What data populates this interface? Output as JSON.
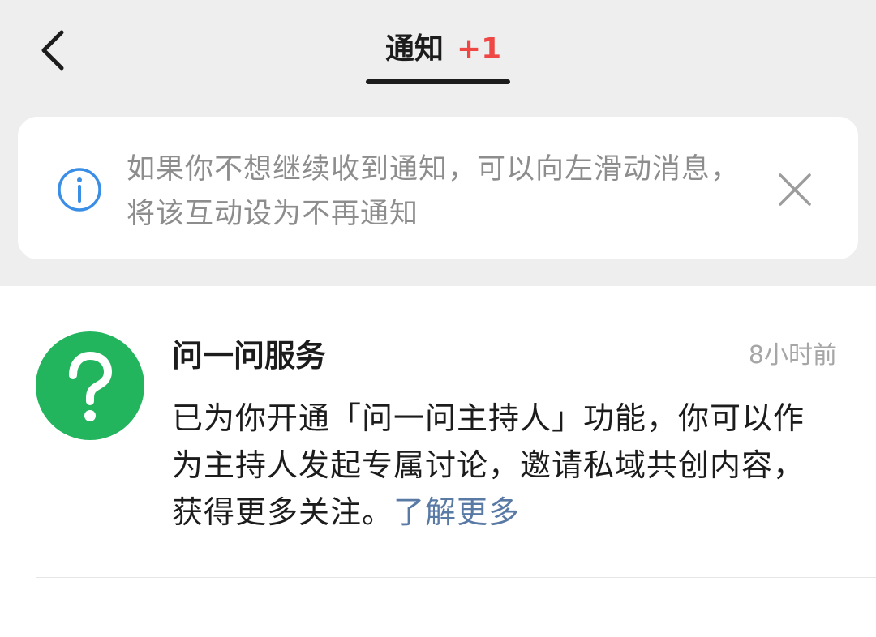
{
  "header": {
    "tab_title": "通知",
    "tab_badge": "+1"
  },
  "tip": {
    "text": "如果你不想继续收到通知，可以向左滑动消息，将该互动设为不再通知"
  },
  "notification": {
    "sender": "问一问服务",
    "time": "8小时前",
    "message": "已为你开通「问一问主持人」功能，你可以作为主持人发起专属讨论，邀请私域共创内容，获得更多关注。",
    "link_label": "了解更多"
  },
  "colors": {
    "accent_red": "#ee4744",
    "avatar_green": "#22b55d",
    "info_blue": "#3a8ee6",
    "link_blue": "#5a7aa6"
  },
  "icons": {
    "back": "chevron-left-icon",
    "info": "info-icon",
    "close": "close-icon",
    "avatar": "question-mark-icon"
  }
}
